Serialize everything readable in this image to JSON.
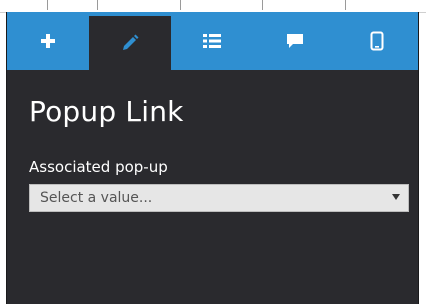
{
  "toolbar": {
    "tabs": [
      {
        "icon": "plus-icon",
        "active": false
      },
      {
        "icon": "pencil-icon",
        "active": true
      },
      {
        "icon": "list-icon",
        "active": false
      },
      {
        "icon": "comment-icon",
        "active": false
      },
      {
        "icon": "mobile-icon",
        "active": false
      }
    ]
  },
  "panel": {
    "title": "Popup Link",
    "field": {
      "label": "Associated pop-up",
      "placeholder": "Select a value..."
    }
  },
  "colors": {
    "accent": "#2f8fd1",
    "panel_bg": "#2a2a2e",
    "select_bg": "#e6e6e6"
  }
}
